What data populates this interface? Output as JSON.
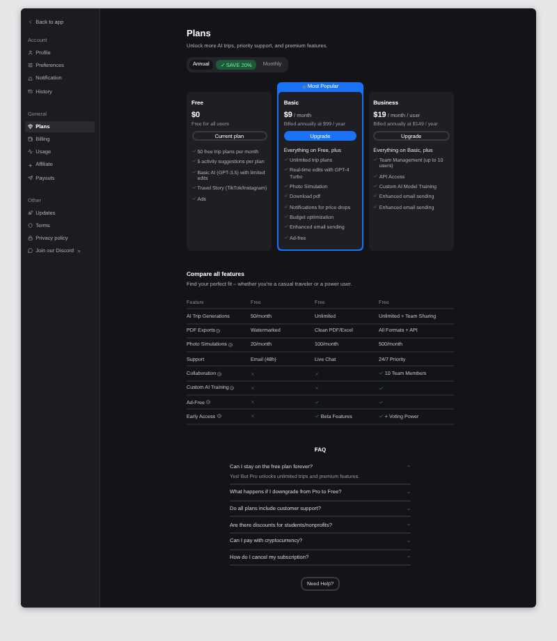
{
  "sidebar": {
    "back": "Back to app",
    "sections": [
      {
        "title": "Account",
        "items": [
          {
            "label": "Profile",
            "selected": false
          },
          {
            "label": "Preferences",
            "selected": false
          },
          {
            "label": "Notification",
            "selected": false
          },
          {
            "label": "History",
            "selected": false
          }
        ]
      },
      {
        "title": "General",
        "items": [
          {
            "label": "Plans",
            "selected": true
          },
          {
            "label": "Billing",
            "selected": false
          },
          {
            "label": "Usage",
            "selected": false
          },
          {
            "label": "Affiliate",
            "selected": false
          },
          {
            "label": "Payouts",
            "selected": false
          }
        ]
      },
      {
        "title": "Other",
        "items": [
          {
            "label": "Updates",
            "selected": false
          },
          {
            "label": "Terms",
            "selected": false
          },
          {
            "label": "Privacy policy",
            "selected": false
          },
          {
            "label": "Join our Discord",
            "selected": false,
            "external": true
          }
        ]
      }
    ]
  },
  "page": {
    "title": "Plans",
    "subtitle": "Unlock more AI trips, priority support, and premium features."
  },
  "billing_toggle": [
    {
      "label": "Annual",
      "selected": true
    },
    {
      "label": "✓ SAVE 20%",
      "kind": "badge"
    },
    {
      "label": "Monthly",
      "selected": false
    }
  ],
  "plans": [
    {
      "name": "Free",
      "price": "$0",
      "billing": "Free for all users",
      "button": "Current plan",
      "primary": false,
      "highlighted": false,
      "features": [
        "50 free trip plans per month",
        "5 activity suggestions per plan",
        "Basic AI (GPT-3.5) with limited edits",
        "Travel Story (TikTok/Instagram)",
        "Ads"
      ]
    },
    {
      "name": "Basic",
      "banner": "Most Popular",
      "price": "$9",
      "unit": "/ month",
      "billing": "Billed annually at $99 / year",
      "button": "Upgrade",
      "primary": true,
      "highlighted": true,
      "intro": "Everything on Free, plus",
      "features": [
        "Unlimited trip plans",
        "Real-time edits with GPT-4 Turbo",
        "Photo Simulation",
        "Download pdf",
        "Notifications for price drops",
        "Budget optimization",
        "Enhanced email sending",
        "Ad-free"
      ]
    },
    {
      "name": "Business",
      "price": "$19",
      "unit": "/ month / user",
      "billing": "Billed annually at $149 / year",
      "button": "Upgrade",
      "primary": false,
      "highlighted": false,
      "intro": "Everything on Basic, plus",
      "features": [
        "Team Management (up to 10 users)",
        "API Access",
        "Custom AI Model Training",
        "Enhanced email sending",
        "Enhanced email sending"
      ]
    }
  ],
  "compare": {
    "title": "Compare all features",
    "subtitle": "Find your perfect fit – whether you're a casual traveler or a power user.",
    "columns": [
      "Feature",
      "Free",
      "Free",
      "Free"
    ],
    "rows": [
      {
        "cells": [
          {
            "kind": "feature",
            "text": "AI Trip Generations",
            "info": false
          },
          {
            "kind": "text",
            "text": "50/month"
          },
          {
            "kind": "text",
            "text": "Unlimited"
          },
          {
            "kind": "text",
            "text": "Unlimited + Team Sharing"
          }
        ]
      },
      {
        "cells": [
          {
            "kind": "feature",
            "text": "PDF Exports",
            "info": true
          },
          {
            "kind": "text",
            "text": "Watermarked"
          },
          {
            "kind": "text",
            "text": "Clean PDF/Excel"
          },
          {
            "kind": "text",
            "text": "All Formats + API"
          }
        ]
      },
      {
        "cells": [
          {
            "kind": "feature",
            "text": "Photo Simulations",
            "info": true
          },
          {
            "kind": "text",
            "text": "20/month"
          },
          {
            "kind": "text",
            "text": "100/month"
          },
          {
            "kind": "text",
            "text": "500/month"
          }
        ]
      },
      {
        "cells": [
          {
            "kind": "feature",
            "text": "Support",
            "info": false
          },
          {
            "kind": "text",
            "text": "Email (48h)"
          },
          {
            "kind": "text",
            "text": "Live Chat"
          },
          {
            "kind": "text",
            "text": "24/7 Priority"
          }
        ]
      },
      {
        "cells": [
          {
            "kind": "feature",
            "text": "Collaboration",
            "info": true
          },
          {
            "kind": "cross"
          },
          {
            "kind": "cross"
          },
          {
            "kind": "check",
            "text": "10 Team Members"
          }
        ]
      },
      {
        "cells": [
          {
            "kind": "feature",
            "text": "Custom AI Training",
            "info": true
          },
          {
            "kind": "cross"
          },
          {
            "kind": "cross"
          },
          {
            "kind": "check"
          }
        ]
      },
      {
        "cells": [
          {
            "kind": "feature",
            "text": "Ad-Free",
            "info": true
          },
          {
            "kind": "cross"
          },
          {
            "kind": "check"
          },
          {
            "kind": "check"
          }
        ]
      },
      {
        "cells": [
          {
            "kind": "feature",
            "text": "Early Access",
            "info": true
          },
          {
            "kind": "cross"
          },
          {
            "kind": "check",
            "text": "Beta Features"
          },
          {
            "kind": "check",
            "text": "+ Voting Power"
          }
        ]
      }
    ]
  },
  "faq": {
    "title": "FAQ",
    "items": [
      {
        "question": "Can I stay on the free plan forever?",
        "expanded": true,
        "answer": "Yes! But Pro unlocks unlimited trips and premium features."
      },
      {
        "question": "What happens if I downgrade from Pro to Free?",
        "expanded": false
      },
      {
        "question": "Do all plans include customer support?",
        "expanded": false
      },
      {
        "question": "Are there discounts for students/nonprofits?",
        "expanded": false
      },
      {
        "question": "Can I pay with cryptocurrency?",
        "expanded": false
      },
      {
        "question": "How do I cancel my subscription?",
        "expanded": false
      }
    ],
    "help_button": "Need Help?"
  }
}
